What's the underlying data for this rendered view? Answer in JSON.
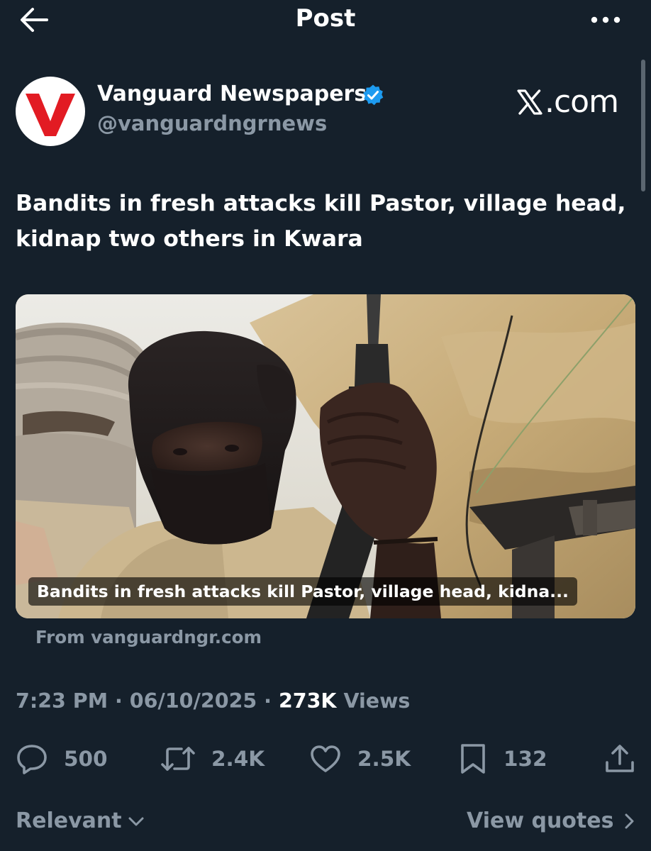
{
  "header": {
    "title": "Post"
  },
  "author": {
    "avatar_letter": "V",
    "name": "Vanguard Newspapers",
    "handle": "@vanguardngrnews",
    "verified": true
  },
  "watermark": {
    "brand_letter": "X",
    "suffix": ".com"
  },
  "post": {
    "text": "Bandits in fresh attacks kill Pastor, village head, kidnap two others in Kwara"
  },
  "card": {
    "caption": "Bandits in fresh attacks kill Pastor, village head, kidna...",
    "source": "From vanguardngr.com"
  },
  "meta": {
    "time": "7:23 PM",
    "separator": "·",
    "date": "06/10/2025",
    "views_count": "273K",
    "views_label": "Views"
  },
  "actions": {
    "replies": "500",
    "reposts": "2.4K",
    "likes": "2.5K",
    "bookmarks": "132"
  },
  "footer": {
    "sort_label": "Relevant",
    "quotes_label": "View quotes"
  },
  "colors": {
    "background": "#15202b",
    "secondary_text": "#8b98a5",
    "verified_blue": "#1d9bf0",
    "brand_red": "#e21b23"
  },
  "icons": [
    "back-arrow-icon",
    "more-icon",
    "verified-badge-icon",
    "reply-icon",
    "repost-icon",
    "like-icon",
    "bookmark-icon",
    "share-icon",
    "chevron-down-icon",
    "chevron-right-icon"
  ]
}
